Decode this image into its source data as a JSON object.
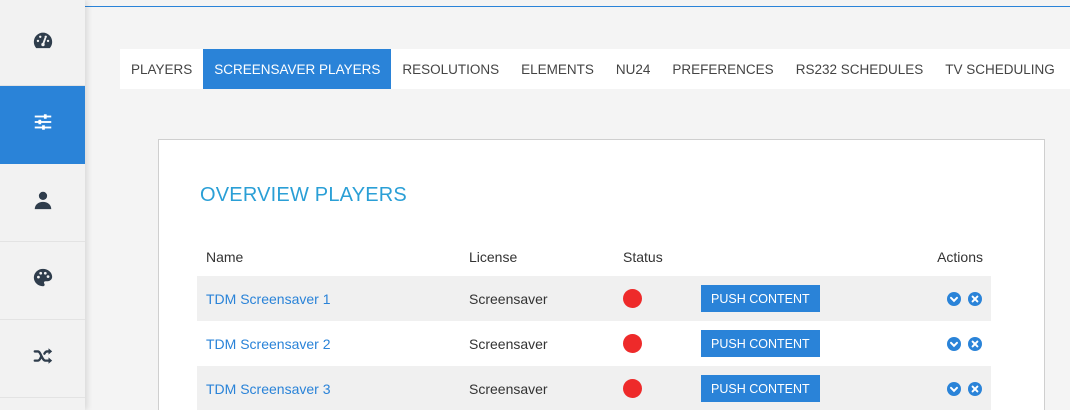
{
  "sidebar": {
    "items": [
      {
        "icon": "dashboard-icon",
        "active": false
      },
      {
        "icon": "sliders-icon",
        "active": true
      },
      {
        "icon": "user-icon",
        "active": false
      },
      {
        "icon": "palette-icon",
        "active": false
      },
      {
        "icon": "shuffle-icon",
        "active": false
      }
    ]
  },
  "tabs": [
    {
      "label": "PLAYERS"
    },
    {
      "label": "SCREENSAVER PLAYERS"
    },
    {
      "label": "RESOLUTIONS"
    },
    {
      "label": "ELEMENTS"
    },
    {
      "label": "NU24"
    },
    {
      "label": "PREFERENCES"
    },
    {
      "label": "RS232 SCHEDULES"
    },
    {
      "label": "TV SCHEDULING"
    }
  ],
  "active_tab": "SCREENSAVER PLAYERS",
  "panel": {
    "title": "OVERVIEW PLAYERS",
    "columns": {
      "name": "Name",
      "license": "License",
      "status": "Status",
      "actions": "Actions"
    },
    "rows": [
      {
        "name": "TDM Screensaver 1",
        "license": "Screensaver",
        "status": "offline",
        "push_label": "PUSH CONTENT"
      },
      {
        "name": "TDM Screensaver 2",
        "license": "Screensaver",
        "status": "offline",
        "push_label": "PUSH CONTENT"
      },
      {
        "name": "TDM Screensaver 3",
        "license": "Screensaver",
        "status": "offline",
        "push_label": "PUSH CONTENT"
      }
    ]
  },
  "colors": {
    "accent": "#2a83d8",
    "title": "#2a9fd6",
    "status_offline": "#ee2a2a"
  }
}
